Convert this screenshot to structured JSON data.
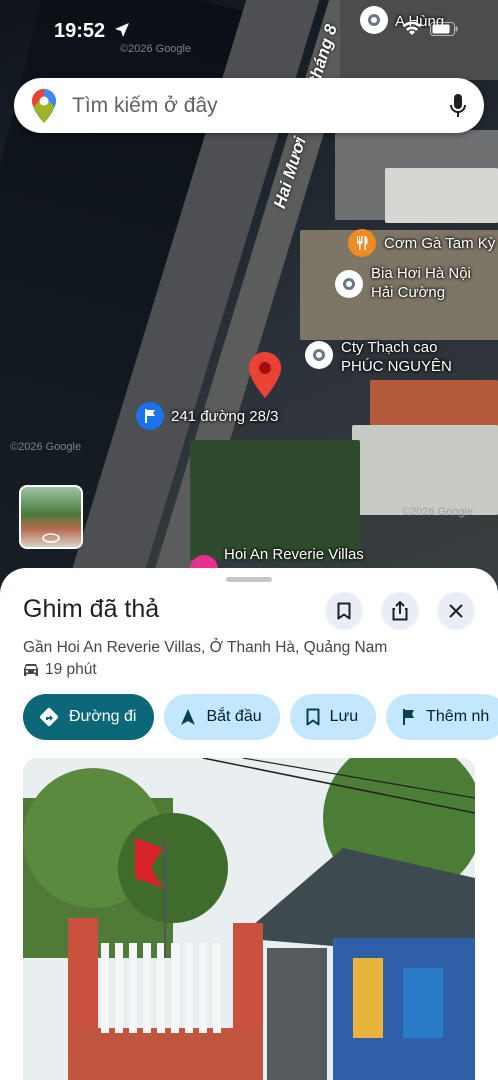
{
  "status_bar": {
    "time": "19:52"
  },
  "search": {
    "placeholder": "Tìm kiếm ở đây"
  },
  "map": {
    "street_labels": [
      "tháng 8",
      "Hai Mươi"
    ],
    "pois": [
      {
        "name": "A Hùng",
        "icon": "place-pin-icon"
      },
      {
        "name": "Cơm Gà Tam Kỳ",
        "icon": "restaurant-icon"
      },
      {
        "name": "Bia Hơi Hà Nội Hải Cường",
        "icon": "place-pin-icon"
      },
      {
        "name": "Cty Thạch cao PHÚC NGUYÊN",
        "icon": "place-pin-icon"
      },
      {
        "name": "241 đường 28/3",
        "icon": "flag-icon"
      },
      {
        "name": "Hoi An Reverie Villas",
        "icon": "hotel-icon"
      }
    ],
    "watermarks": [
      "©2026 Google",
      "©2026 Google",
      "©2026 Google"
    ]
  },
  "place": {
    "title": "Ghim đã thả",
    "subtitle": "Gần Hoi An Reverie Villas, Ở Thanh Hà, Quảng Nam",
    "eta": "19 phút"
  },
  "actions": [
    {
      "label": "Đường đi",
      "icon": "directions-icon",
      "primary": true
    },
    {
      "label": "Bắt đầu",
      "icon": "navigation-arrow-icon",
      "primary": false
    },
    {
      "label": "Lưu",
      "icon": "bookmark-icon",
      "primary": false
    },
    {
      "label": "Thêm nh",
      "icon": "flag-icon",
      "primary": false
    }
  ],
  "colors": {
    "accent": "#0b6878",
    "chip": "#c2e7ff",
    "pin": "#ea4335"
  }
}
